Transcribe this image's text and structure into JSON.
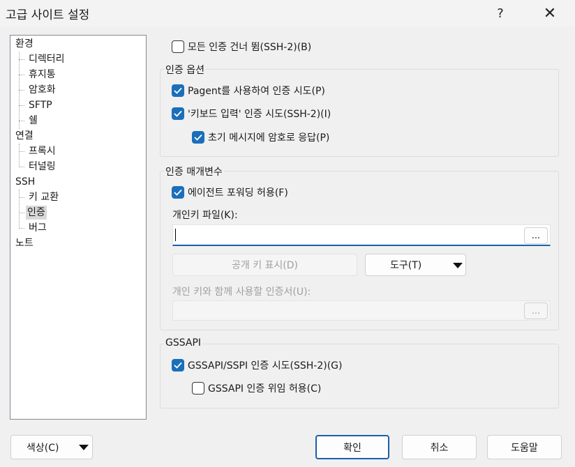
{
  "window": {
    "title": "고급 사이트 설정",
    "help_label": "?",
    "close_label": "✕"
  },
  "tree": {
    "items": [
      {
        "label": "환경"
      },
      {
        "label": "디렉터리"
      },
      {
        "label": "휴지통"
      },
      {
        "label": "암호화"
      },
      {
        "label": "SFTP"
      },
      {
        "label": "쉘"
      },
      {
        "label": "연결"
      },
      {
        "label": "프록시"
      },
      {
        "label": "터널링"
      },
      {
        "label": "SSH"
      },
      {
        "label": "키 교환"
      },
      {
        "label": "인증",
        "selected": true
      },
      {
        "label": "버그"
      },
      {
        "label": "노트"
      }
    ]
  },
  "bypass": {
    "label": "모든 인증 건너 뜀(SSH-2)(B)",
    "checked": false
  },
  "auth_options": {
    "title": "인증 옵션",
    "pageant": {
      "label": "Pagent를 사용하여 인증 시도(P)",
      "checked": true
    },
    "keyboard": {
      "label": "'키보드 입력' 인증 시도(SSH-2)(I)",
      "checked": true
    },
    "password_first": {
      "label": "초기 메시지에 암호로 응답(P)",
      "checked": true
    }
  },
  "auth_params": {
    "title": "인증 매개변수",
    "agent_forward": {
      "label": "에이전트 포워딩 허용(F)",
      "checked": true
    },
    "private_key_label": "개인키 파일(K):",
    "private_key_value": "",
    "browse_label": "...",
    "show_public_key_label": "공개 키 표시(D)",
    "tools_label": "도구(T)",
    "cert_label": "개인 키와 함께 사용할 인증서(U):",
    "cert_value": "",
    "cert_browse_label": "..."
  },
  "gssapi": {
    "title": "GSSAPI",
    "attempt": {
      "label": "GSSAPI/SSPI 인증 시도(SSH-2)(G)",
      "checked": true
    },
    "delegation": {
      "label": "GSSAPI 인증 위임 허용(C)",
      "checked": false
    }
  },
  "footer": {
    "color_label": "색상(C)",
    "ok_label": "확인",
    "cancel_label": "취소",
    "help_label": "도움말"
  },
  "colors": {
    "accent": "#1b6fba",
    "focus_border": "#1b5fa8"
  }
}
